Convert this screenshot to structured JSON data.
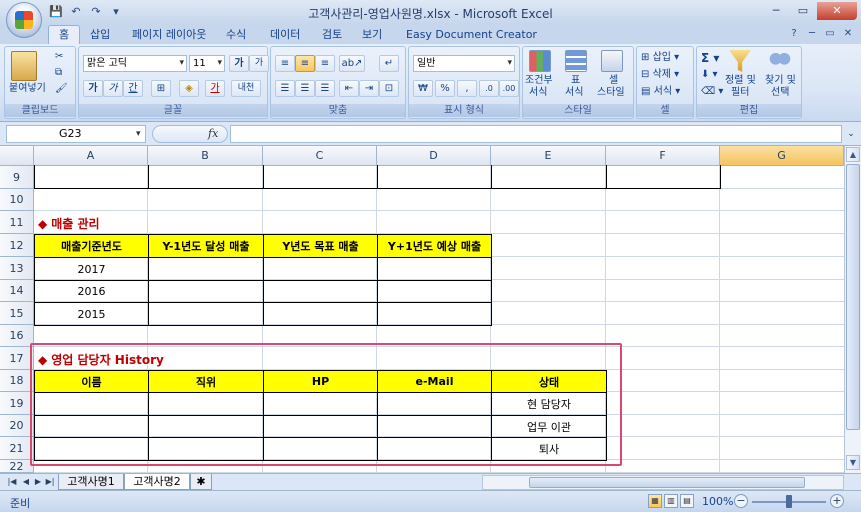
{
  "window": {
    "title": "고객사관리-영업사원명.xlsx - Microsoft Excel",
    "controls": [
      "─",
      "▭",
      "✕"
    ]
  },
  "qat": [
    "💾",
    "↶",
    "↷",
    "▾"
  ],
  "tabs": [
    "홈",
    "삽입",
    "페이지 레이아웃",
    "수식",
    "데이터",
    "검토",
    "보기",
    "Easy Document Creator"
  ],
  "ribbon": {
    "clipboard": {
      "paste_label": "붙여넣기",
      "group_label": "클립보드"
    },
    "font": {
      "font_name": "맑은 고딕",
      "font_size": "11",
      "grow": "가",
      "shrink": "가",
      "bold": "가",
      "italic": "가",
      "underline": "간",
      "color_letter": "가",
      "phonetic": "내천",
      "group_label": "글꼴"
    },
    "alignment": {
      "group_label": "맞춤"
    },
    "number": {
      "format": "일반",
      "currency": "₩",
      "percent": "%",
      "comma": ",",
      "group_label": "표시 형식"
    },
    "styles": {
      "conditional_l1": "조건부",
      "conditional_l2": "서식",
      "table_l1": "표",
      "table_l2": "서식",
      "cell_l1": "셀",
      "cell_l2": "스타일",
      "group_label": "스타일"
    },
    "cells": {
      "insert": "삽입",
      "delete": "삭제",
      "format": "서식",
      "group_label": "셀"
    },
    "editing": {
      "sort_l1": "정렬 및",
      "sort_l2": "필터",
      "find_l1": "찾기 및",
      "find_l2": "선택",
      "group_label": "편집"
    }
  },
  "formula_bar": {
    "name_box": "G23",
    "fx": "fx",
    "formula": ""
  },
  "columns": [
    "A",
    "B",
    "C",
    "D",
    "E",
    "F",
    "G"
  ],
  "rows": [
    "9",
    "10",
    "11",
    "12",
    "13",
    "14",
    "15",
    "16",
    "17",
    "18",
    "19",
    "20",
    "21",
    "22"
  ],
  "sales": {
    "title": "매출 관리",
    "headers": [
      "매출기준년도",
      "Y-1년도 달성 매출",
      "Y년도 목표 매출",
      "Y+1년도 예상 매출"
    ],
    "years": [
      "2017",
      "2016",
      "2015"
    ]
  },
  "history": {
    "title": "영업 담당자 History",
    "headers": [
      "이름",
      "직위",
      "HP",
      "e-Mail",
      "상태"
    ],
    "statuses": [
      "현 담당자",
      "업무 이관",
      "퇴사"
    ]
  },
  "sheets": [
    "고객사명1",
    "고객사명2"
  ],
  "status": {
    "ready": "준비",
    "zoom": "100%"
  },
  "colors": {
    "header_fill": "#ffff00",
    "title_red": "#c00000",
    "highlight_border": "#d9496d"
  }
}
